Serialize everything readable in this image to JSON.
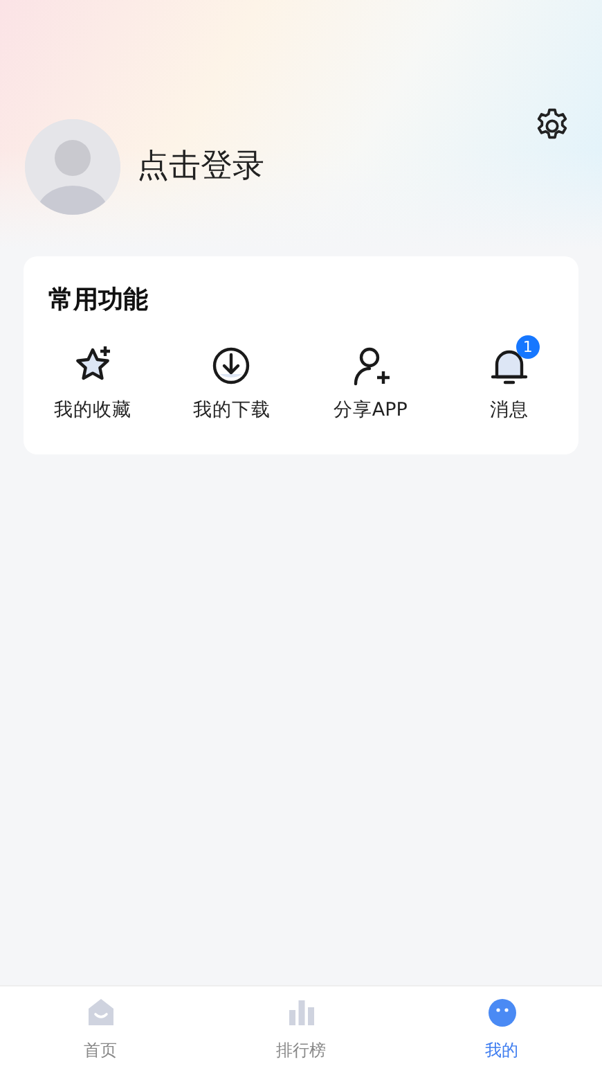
{
  "profile": {
    "login_text": "点击登录"
  },
  "features": {
    "title": "常用功能",
    "items": [
      {
        "label": "我的收藏"
      },
      {
        "label": "我的下载"
      },
      {
        "label": "分享APP"
      },
      {
        "label": "消息",
        "badge": "1"
      }
    ]
  },
  "tab_bar": [
    {
      "label": "首页",
      "selected": false
    },
    {
      "label": "排行榜",
      "selected": false
    },
    {
      "label": "我的",
      "selected": true
    }
  ]
}
